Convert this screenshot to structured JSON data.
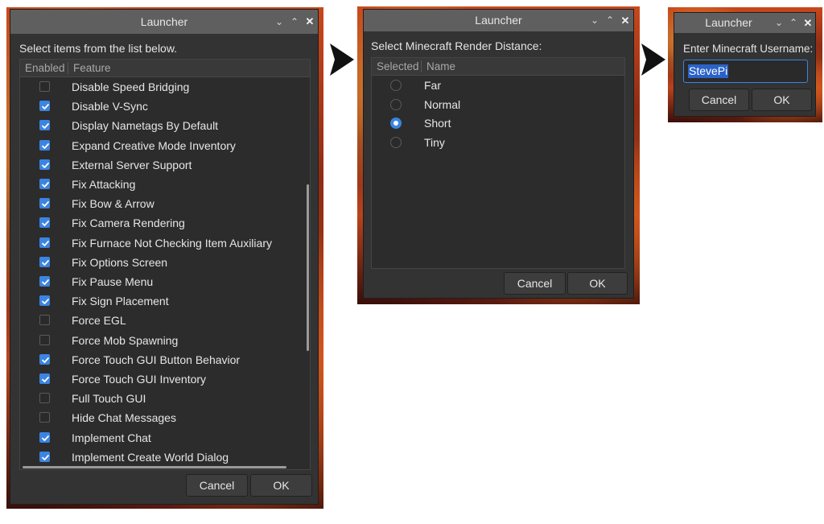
{
  "dialogs": {
    "features": {
      "title": "Launcher",
      "prompt": "Select items from the list below.",
      "columns": [
        "Enabled",
        "Feature"
      ],
      "items": [
        {
          "label": "Disable Speed Bridging",
          "enabled": false
        },
        {
          "label": "Disable V-Sync",
          "enabled": true
        },
        {
          "label": "Display Nametags By Default",
          "enabled": true
        },
        {
          "label": "Expand Creative Mode Inventory",
          "enabled": true
        },
        {
          "label": "External Server Support",
          "enabled": true
        },
        {
          "label": "Fix Attacking",
          "enabled": true
        },
        {
          "label": "Fix Bow & Arrow",
          "enabled": true
        },
        {
          "label": "Fix Camera Rendering",
          "enabled": true
        },
        {
          "label": "Fix Furnace Not Checking Item Auxiliary",
          "enabled": true
        },
        {
          "label": "Fix Options Screen",
          "enabled": true
        },
        {
          "label": "Fix Pause Menu",
          "enabled": true
        },
        {
          "label": "Fix Sign Placement",
          "enabled": true
        },
        {
          "label": "Force EGL",
          "enabled": false
        },
        {
          "label": "Force Mob Spawning",
          "enabled": false
        },
        {
          "label": "Force Touch GUI Button Behavior",
          "enabled": true
        },
        {
          "label": "Force Touch GUI Inventory",
          "enabled": true
        },
        {
          "label": "Full Touch GUI",
          "enabled": false
        },
        {
          "label": "Hide Chat Messages",
          "enabled": false
        },
        {
          "label": "Implement Chat",
          "enabled": true
        },
        {
          "label": "Implement Create World Dialog",
          "enabled": true
        }
      ],
      "cancel_label": "Cancel",
      "ok_label": "OK"
    },
    "render_distance": {
      "title": "Launcher",
      "prompt": "Select Minecraft Render Distance:",
      "columns": [
        "Selected",
        "Name"
      ],
      "options": [
        {
          "label": "Far",
          "selected": false
        },
        {
          "label": "Normal",
          "selected": false
        },
        {
          "label": "Short",
          "selected": true
        },
        {
          "label": "Tiny",
          "selected": false
        }
      ],
      "cancel_label": "Cancel",
      "ok_label": "OK"
    },
    "username": {
      "title": "Launcher",
      "prompt": "Enter Minecraft Username:",
      "value": "StevePi",
      "cancel_label": "Cancel",
      "ok_label": "OK"
    }
  },
  "window_controls": {
    "minimize": "⌄",
    "maximize": "⌃",
    "close": "✕"
  },
  "icons": {
    "flow_arrow": "triangle-right-icon",
    "minimize": "chevron-down-icon",
    "maximize": "chevron-up-icon",
    "close": "close-icon",
    "checkbox": "checkbox-icon",
    "radio": "radio-icon"
  },
  "colors": {
    "accent": "#3b84e2",
    "dialog_bg": "#333333",
    "titlebar_bg": "#5f5f5f"
  }
}
